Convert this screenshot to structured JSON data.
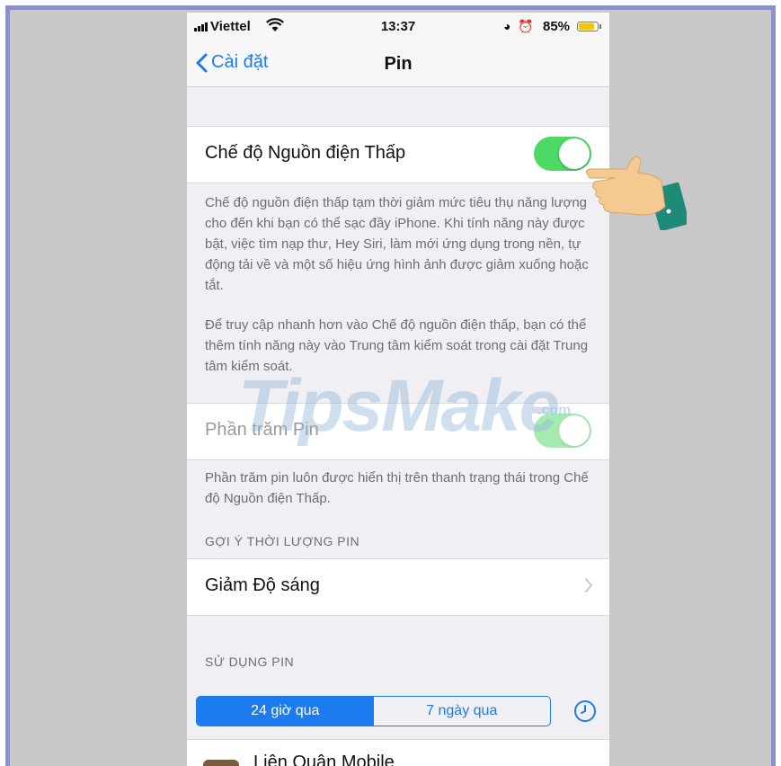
{
  "status_bar": {
    "carrier": "Viettel",
    "time": "13:37",
    "battery_percent": "85%",
    "battery_level": 0.85,
    "icons": [
      "signal-icon",
      "wifi-icon",
      "rotation-lock-icon",
      "alarm-icon",
      "battery-icon"
    ]
  },
  "nav": {
    "back_label": "Cài đặt",
    "title": "Pin"
  },
  "low_power": {
    "label": "Chế độ Nguồn điện Thấp",
    "enabled": true,
    "description_1": "Chế độ nguồn điện thấp tạm thời giảm mức tiêu thụ năng lượng cho đến khi bạn có thể sạc đầy iPhone. Khi tính năng này được bật, việc tìm nạp thư, Hey Siri, làm mới ứng dụng trong nền, tự động tải về và một số hiệu ứng hình ảnh được giảm xuống hoặc tắt.",
    "description_2": "Để truy cập nhanh hơn vào Chế độ nguồn điện thấp, bạn có thể thêm tính năng này vào Trung tâm kiểm soát trong cài đặt Trung tâm kiểm soát."
  },
  "battery_percentage": {
    "label": "Phần trăm Pin",
    "enabled": true,
    "disabled_state": true,
    "description": "Phần trăm pin luôn được hiển thị trên thanh trạng thái trong Chế độ Nguồn điện Thấp."
  },
  "suggestions": {
    "section_title": "GỢI Ý THỜI LƯỢNG PIN",
    "item_label": "Giảm Độ sáng"
  },
  "usage": {
    "section_title": "SỬ DỤNG PIN",
    "tabs": [
      "24 giờ qua",
      "7 ngày qua"
    ],
    "selected_tab": 0,
    "first_app": "Liên Quân Mobile"
  },
  "watermark": {
    "text": "TipsMake",
    "suffix": ".com"
  },
  "colors": {
    "accent": "#1d7bf0",
    "toggle_on": "#4cd964",
    "background": "#efeff4"
  }
}
